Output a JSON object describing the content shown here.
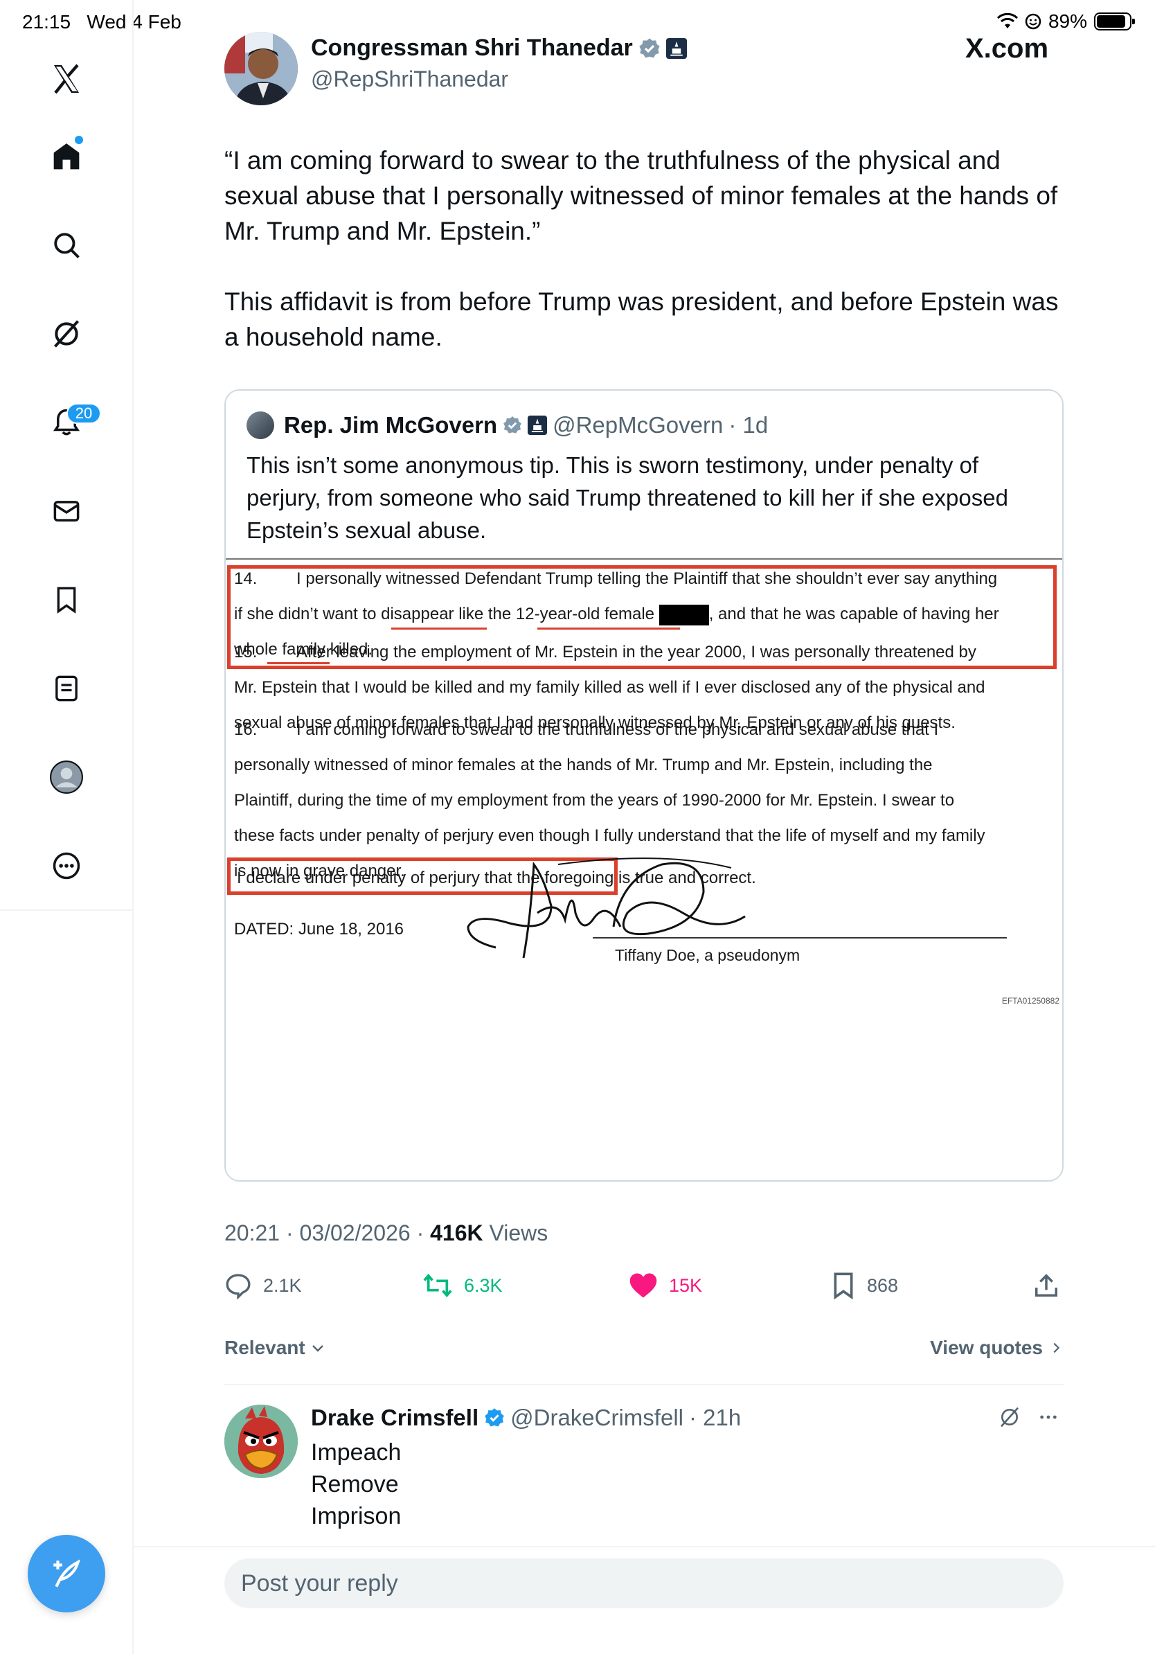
{
  "status_bar": {
    "time": "21:15",
    "date": "Wed 4 Feb",
    "battery": "89%",
    "battery_level": 0.89
  },
  "site_label": "X.com",
  "nav": {
    "items": [
      "x-logo",
      "home",
      "search",
      "grok",
      "notifications",
      "messages",
      "bookmarks",
      "lists",
      "profile",
      "more"
    ],
    "notifications_badge": "20"
  },
  "post": {
    "author_name": "Congressman Shri Thanedar",
    "author_handle": "@RepShriThanedar",
    "text_p1": "“I am coming forward to swear to the truthfulness of the physical and sexual abuse that I personally witnessed of minor females at the hands of Mr. Trump and Mr. Epstein.”",
    "text_p2": "This affidavit is from before Trump was president, and before Epstein was a household name.",
    "timestamp": "20:21 · 03/02/2026 · ",
    "views_count": "416K",
    "views_label": " Views",
    "stats": {
      "replies": "2.1K",
      "reposts": "6.3K",
      "likes": "15K",
      "bookmarks": "868"
    }
  },
  "quoted": {
    "author_name": "Rep. Jim McGovern",
    "author_handle": "@RepMcGovern",
    "time": "· 1d",
    "text": "This isn’t some anonymous tip. This is sworn testimony, under penalty of perjury, from someone who said Trump threatened to kill her if she exposed Epstein’s sexual abuse.",
    "document": {
      "p14_num": "14.",
      "p14_a": "I personally witnessed Defendant Trump telling the Plaintiff that she shouldn’t ever say anything",
      "p14_b1": "if she didn’t want to disappear like the 12-year-old female ",
      "p14_b2": ", and that he was capable of having her",
      "p14_c": "whole family killed.",
      "p15_num": "15.",
      "p15_a": "After leaving the employment of Mr. Epstein in the year 2000, I was personally threatened by",
      "p15_b": "Mr. Epstein that I would be killed and my family killed as well if I ever disclosed any of the physical and",
      "p15_c": "sexual abuse of minor females that I had personally witnessed by Mr. Epstein or any of his guests.",
      "p16_num": "16.",
      "p16_a": "I am coming forward to swear to the truthfulness of the physical and sexual abuse that I",
      "p16_b": "personally witnessed of minor females at the hands of Mr. Trump and Mr. Epstein, including the",
      "p16_c": "Plaintiff, during the time of my employment from the years of 1990-2000 for Mr. Epstein.  I swear to",
      "p16_d": "these facts under penalty of perjury even though I fully understand that the life of myself and my family",
      "p16_e": "is now in grave danger.",
      "declaration": "I declare under penalty of perjury that the foregoing is true and correct.",
      "dated": "DATED:  June 18, 2016",
      "signer": "Tiffany Doe, a pseudonym",
      "doc_id": "EFTA01250882"
    }
  },
  "sort": {
    "relevant_label": "Relevant",
    "view_quotes_label": "View quotes"
  },
  "reply": {
    "author_name": "Drake Crimsfell",
    "author_handle": "@DrakeCrimsfell",
    "time": "· 21h",
    "lines": [
      "Impeach",
      "Remove",
      "Imprison"
    ]
  },
  "composer": {
    "placeholder": "Post your reply"
  },
  "colors": {
    "accent": "#1d9bf0",
    "like": "#f91880",
    "repost": "#00ba7c",
    "muted": "#536471",
    "annotation_red": "#d9412c"
  }
}
